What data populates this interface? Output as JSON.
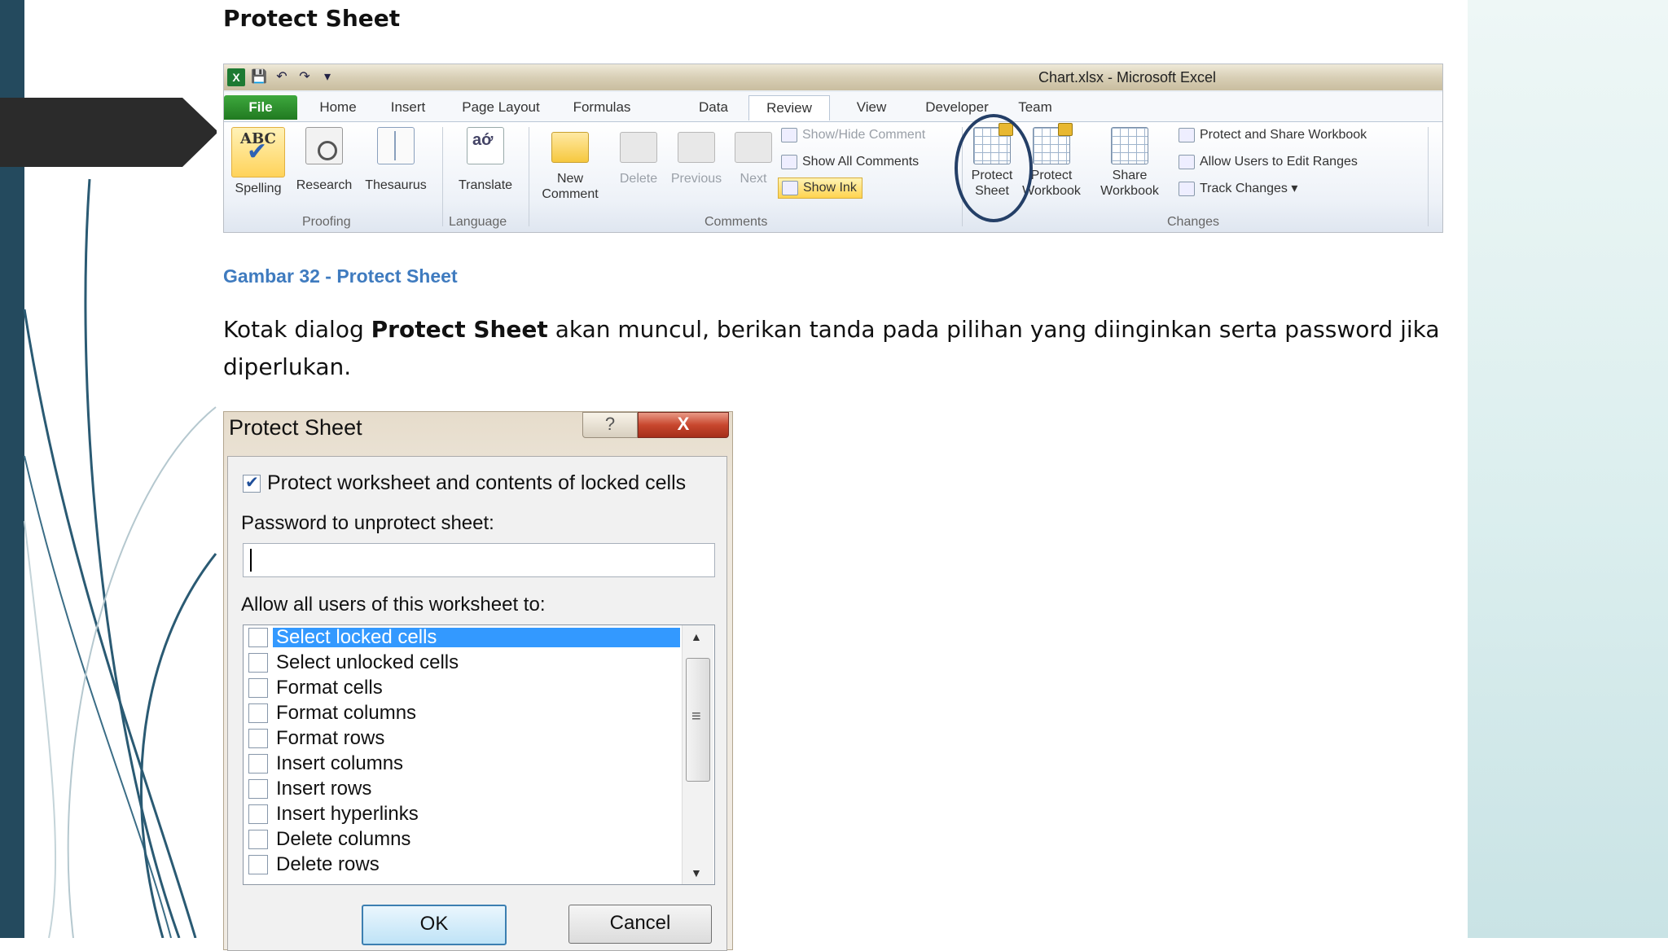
{
  "doc": {
    "title": "Protect Sheet",
    "caption": "Gambar 32 - Protect Sheet",
    "para_prefix": "Kotak dialog ",
    "para_bold": "Protect Sheet",
    "para_suffix": " akan muncul, berikan tanda pada pilihan yang diinginkan serta password jika diperlukan."
  },
  "excel": {
    "window_title": "Chart.xlsx  -  Microsoft Excel",
    "tabs": [
      "File",
      "Home",
      "Insert",
      "Page Layout",
      "Formulas",
      "Data",
      "Review",
      "View",
      "Developer",
      "Team"
    ],
    "active_tab": "Review",
    "proofing": {
      "spelling": "Spelling",
      "research": "Research",
      "thesaurus": "Thesaurus",
      "group": "Proofing"
    },
    "language": {
      "translate": "Translate",
      "group": "Language"
    },
    "comments": {
      "new_comment_1": "New",
      "new_comment_2": "Comment",
      "delete": "Delete",
      "previous": "Previous",
      "next": "Next",
      "show_hide": "Show/Hide Comment",
      "show_all": "Show All Comments",
      "show_ink": "Show Ink",
      "group": "Comments"
    },
    "changes": {
      "protect_sheet_1": "Protect",
      "protect_sheet_2": "Sheet",
      "protect_workbook_1": "Protect",
      "protect_workbook_2": "Workbook",
      "share_workbook_1": "Share",
      "share_workbook_2": "Workbook",
      "protect_share": "Protect and Share Workbook",
      "allow_users": "Allow Users to Edit Ranges",
      "track_changes": "Track Changes",
      "group": "Changes"
    }
  },
  "dialog": {
    "title": "Protect Sheet",
    "help": "?",
    "close": "X",
    "protect_checkbox_label": "Protect worksheet and contents of locked cells",
    "protect_checked": true,
    "password_label": "Password to unprotect sheet:",
    "password_value": "",
    "allow_label": "Allow all users of this worksheet to:",
    "options": [
      "Select locked cells",
      "Select unlocked cells",
      "Format cells",
      "Format columns",
      "Format rows",
      "Insert columns",
      "Insert rows",
      "Insert hyperlinks",
      "Delete columns",
      "Delete rows"
    ],
    "selected_option": "Select locked cells",
    "ok": "OK",
    "cancel": "Cancel"
  }
}
